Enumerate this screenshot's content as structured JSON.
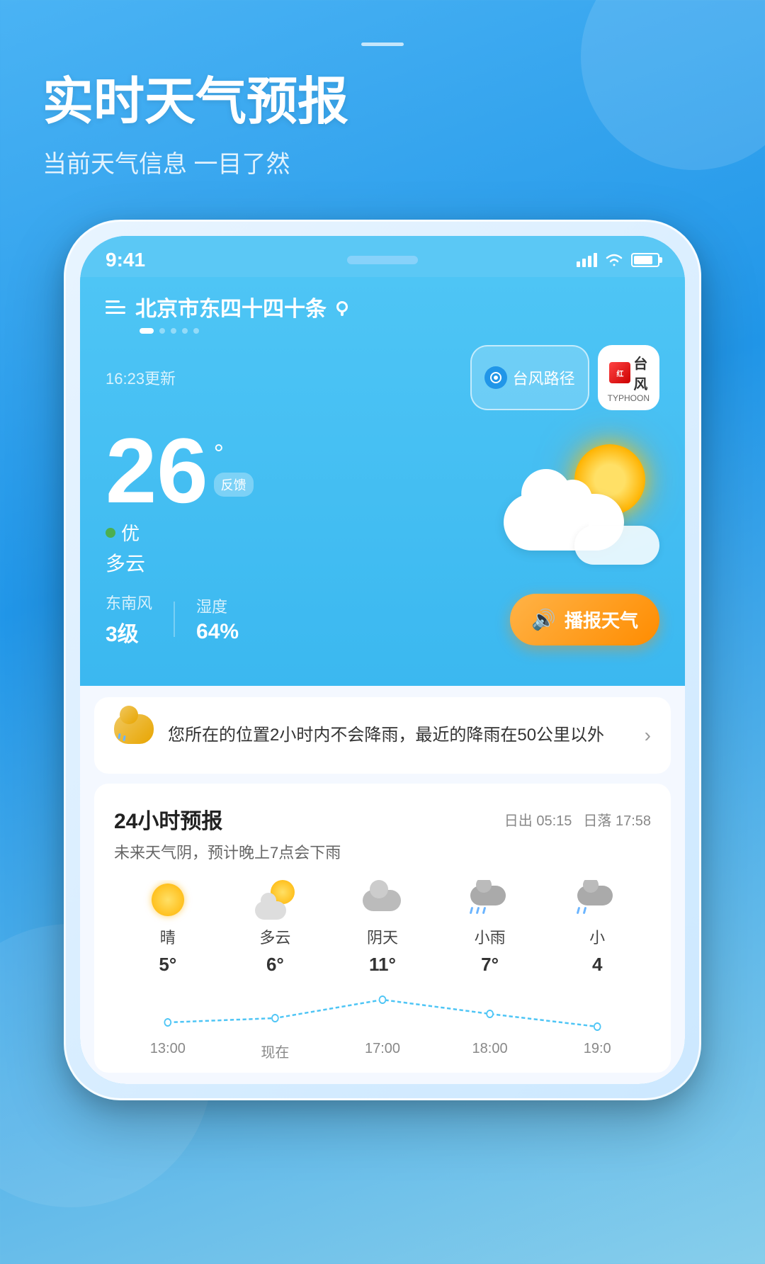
{
  "app": {
    "title": "实时天气预报",
    "subtitle": "当前天气信息 一目了然"
  },
  "phone": {
    "status_time": "9:41",
    "location": "北京市东四十四十条街",
    "location_short": "北京市东四十四十条",
    "update_time": "16:23更新",
    "typhoon_path_label": "台风路径",
    "typhoon_badge_line1": "台",
    "typhoon_badge_line2": "风",
    "typhoon_sub": "TYPHOON",
    "temperature": "26",
    "degree": "°",
    "feedback": "反馈",
    "quality_label": "优",
    "weather_desc": "多云",
    "wind_dir": "东南风",
    "wind_level_label": "3级",
    "humidity_label": "湿度",
    "humidity_value": "64%",
    "broadcast_label": "播报天气",
    "rain_notice": "您所在的位置2小时内不会降雨，最近的降雨在50公里以外",
    "forecast_title": "24小时预报",
    "sunrise": "日出 05:15",
    "sunset": "日落 17:58",
    "forecast_summary": "未来天气阴，预计晚上7点会下雨",
    "hourly": [
      {
        "time": "13:00",
        "weather": "晴",
        "icon": "sunny",
        "temp": "5°"
      },
      {
        "time": "现在",
        "weather": "多云",
        "icon": "partly_cloudy",
        "temp": "6°"
      },
      {
        "time": "17:00",
        "weather": "阴天",
        "icon": "cloudy",
        "temp": "11°"
      },
      {
        "time": "18:00",
        "weather": "小雨",
        "icon": "rain",
        "temp": "7°"
      },
      {
        "time": "19:0",
        "weather": "小",
        "icon": "rain",
        "temp": "4"
      }
    ],
    "chart_temps": [
      5,
      6,
      11,
      7,
      4
    ]
  }
}
